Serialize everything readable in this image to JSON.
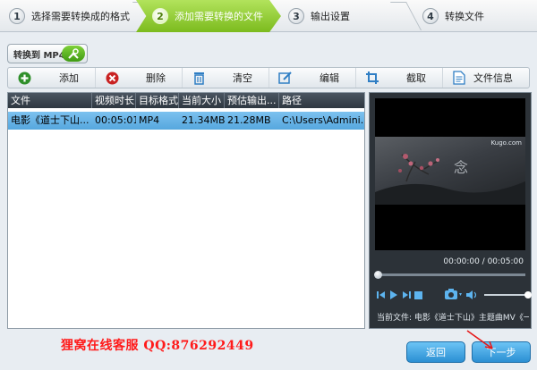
{
  "wizard": {
    "steps": [
      {
        "num": "1",
        "label": "选择需要转换成的格式"
      },
      {
        "num": "2",
        "label": "添加需要转换的文件"
      },
      {
        "num": "3",
        "label": "输出设置"
      },
      {
        "num": "4",
        "label": "转换文件"
      }
    ],
    "active_step": 2,
    "accent_color": "#8cc63f"
  },
  "convert_to": {
    "label": "转换到 MP4",
    "icon": "tools-icon"
  },
  "toolbar": {
    "add": {
      "label": "添加",
      "icon": "add-icon"
    },
    "delete": {
      "label": "删除",
      "icon": "delete-icon"
    },
    "clear": {
      "label": "清空",
      "icon": "trash-icon"
    },
    "edit": {
      "label": "编辑",
      "icon": "edit-icon"
    },
    "crop": {
      "label": "截取",
      "icon": "crop-icon"
    },
    "info": {
      "label": "文件信息",
      "icon": "file-info-icon"
    }
  },
  "table": {
    "columns": [
      "文件",
      "视频时长",
      "目标格式",
      "当前大小",
      "预估输出...",
      "路径"
    ],
    "rows": [
      {
        "file": "电影《道士下山...",
        "duration": "00:05:01",
        "format": "MP4",
        "size": "21.34MB",
        "estimated": "21.28MB",
        "path": "C:\\Users\\Admini...",
        "selected": true
      }
    ]
  },
  "preview": {
    "watermark": "Kugo.com",
    "time": "00:00:00 / 00:05:00",
    "current_file": "当前文件: 电影《道士下山》主题曲MV《一念",
    "seek_progress": 0
  },
  "service_text": "狸窝在线客服 QQ:876292449",
  "buttons": {
    "back": "返回",
    "next": "下一步"
  }
}
